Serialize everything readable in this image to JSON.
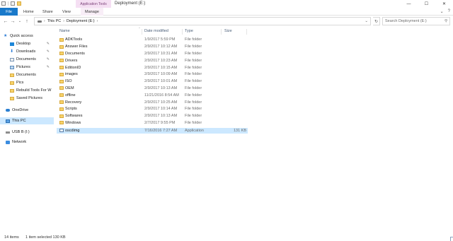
{
  "window": {
    "context_tab": "Application Tools",
    "title": "Deployment (E:)",
    "minimize_glyph": "—",
    "maximize_glyph": "☐",
    "close_glyph": "✕"
  },
  "ribbon": {
    "file": "File",
    "home": "Home",
    "share": "Share",
    "view": "View",
    "manage": "Manage",
    "expand_glyph": "⌄",
    "help_glyph": "?"
  },
  "address": {
    "back_glyph": "←",
    "forward_glyph": "→",
    "recent_glyph": "⌄",
    "up_glyph": "↑",
    "crumbs": [
      "This PC",
      "Deployment (E:)"
    ],
    "chevron": "›",
    "dropdown_glyph": "⌄",
    "refresh_glyph": "↻",
    "search_placeholder": "Search Deployment (E:)",
    "search_glyph": "⚲"
  },
  "nav": {
    "quick_access": "Quick access",
    "items": [
      {
        "label": "Desktop",
        "icon": "desktop",
        "pinned": true
      },
      {
        "label": "Downloads",
        "icon": "download",
        "pinned": true
      },
      {
        "label": "Documents",
        "icon": "docs",
        "pinned": true
      },
      {
        "label": "Pictures",
        "icon": "pics",
        "pinned": true
      },
      {
        "label": "Documents",
        "icon": "folder",
        "pinned": false
      },
      {
        "label": "Pics",
        "icon": "folder",
        "pinned": false
      },
      {
        "label": "Rebuild Tools For W",
        "icon": "folder",
        "pinned": false
      },
      {
        "label": "Saved Pictures",
        "icon": "folder",
        "pinned": false
      }
    ],
    "onedrive": "OneDrive",
    "this_pc": "This PC",
    "usb": "USB B (I:)",
    "network": "Network",
    "pin_glyph": "✎"
  },
  "columns": {
    "name": "Name",
    "date": "Date modified",
    "type": "Type",
    "size": "Size",
    "sort_glyph": "^"
  },
  "files": [
    {
      "name": "ADKTools",
      "date": "1/9/2017 5:59 PM",
      "type": "File folder",
      "size": ""
    },
    {
      "name": "Answer Files",
      "date": "2/9/2017 10:12 AM",
      "type": "File folder",
      "size": ""
    },
    {
      "name": "Documents",
      "date": "2/9/2017 10:31 AM",
      "type": "File folder",
      "size": ""
    },
    {
      "name": "Drivers",
      "date": "2/9/2017 10:23 AM",
      "type": "File folder",
      "size": ""
    },
    {
      "name": "EditionID",
      "date": "2/9/2017 10:15 AM",
      "type": "File folder",
      "size": ""
    },
    {
      "name": "images",
      "date": "2/9/2017 10:09 AM",
      "type": "File folder",
      "size": ""
    },
    {
      "name": "ISO",
      "date": "2/9/2017 10:01 AM",
      "type": "File folder",
      "size": ""
    },
    {
      "name": "OEM",
      "date": "2/9/2017 10:13 AM",
      "type": "File folder",
      "size": ""
    },
    {
      "name": "offline",
      "date": "11/21/2016 8:54 AM",
      "type": "File folder",
      "size": ""
    },
    {
      "name": "Recovery",
      "date": "2/9/2017 10:25 AM",
      "type": "File folder",
      "size": ""
    },
    {
      "name": "Scripts",
      "date": "2/9/2017 10:14 AM",
      "type": "File folder",
      "size": ""
    },
    {
      "name": "Softwares",
      "date": "2/9/2017 10:13 AM",
      "type": "File folder",
      "size": ""
    },
    {
      "name": "Windows",
      "date": "2/7/2017 9:55 PM",
      "type": "File folder",
      "size": ""
    },
    {
      "name": "oscdimg",
      "date": "7/16/2016 7:27 AM",
      "type": "Application",
      "size": "131 KB",
      "selected": true
    }
  ],
  "status": {
    "count": "14 items",
    "selection": "1 item selected  130 KB"
  }
}
